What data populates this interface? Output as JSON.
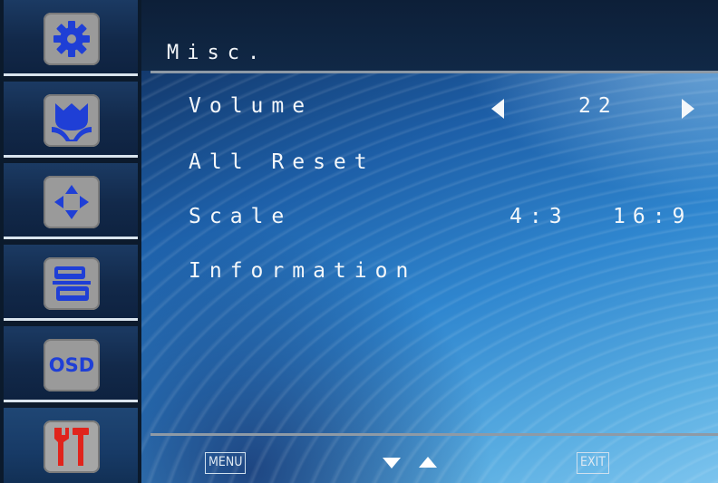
{
  "sidebar": {
    "items": [
      {
        "icon": "gear-icon"
      },
      {
        "icon": "tulip-icon"
      },
      {
        "icon": "position-arrows-icon"
      },
      {
        "icon": "connector-icon"
      },
      {
        "icon": "osd-icon",
        "label": "OSD"
      },
      {
        "icon": "tools-icon"
      }
    ]
  },
  "menu": {
    "title": "Misc.",
    "items": [
      {
        "label": "Volume",
        "value": "22"
      },
      {
        "label": "All Reset"
      },
      {
        "label": "Scale",
        "options": [
          "4:3",
          "16:9"
        ]
      },
      {
        "label": "Information"
      }
    ]
  },
  "footer": {
    "menu_label": "MENU",
    "exit_label": "EXIT"
  },
  "colors": {
    "tile_gray": "#9a9a9a",
    "icon_blue": "#1f3fd6",
    "tools_red": "#e0241c"
  }
}
